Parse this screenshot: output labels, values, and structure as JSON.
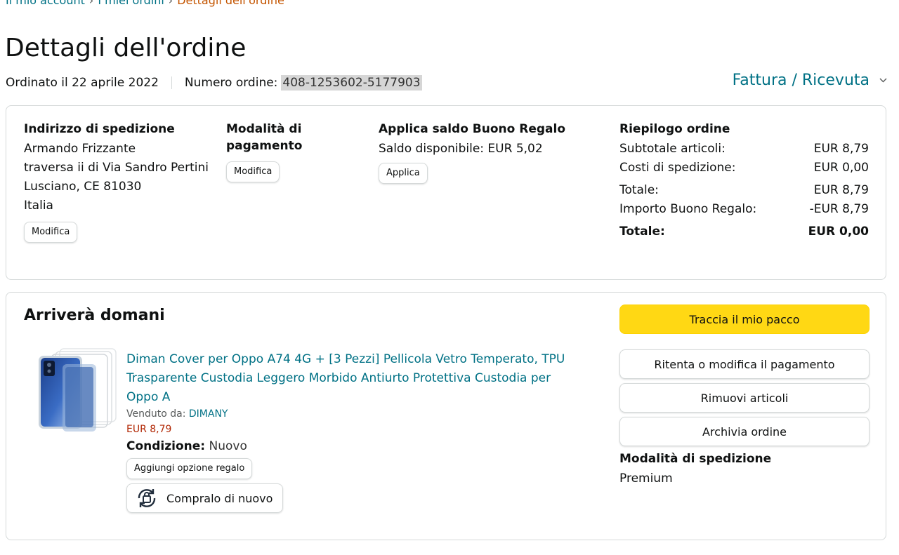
{
  "breadcrumb": {
    "items": [
      "Il mio account",
      "I miei ordini"
    ],
    "current": "Dettagli dell'ordine",
    "separator": "›"
  },
  "page": {
    "title": "Dettagli dell'ordine",
    "ordered_on": "Ordinato il 22 aprile 2022",
    "order_number_label": "Numero ordine:",
    "order_number": "408-1253602-5177903",
    "invoice_link": "Fattura / Ricevuta"
  },
  "shipping_address": {
    "heading": "Indirizzo di spedizione",
    "lines": [
      "Armando Frizzante",
      "traversa ii di Via Sandro Pertini",
      "Lusciano, CE 81030",
      "Italia"
    ],
    "edit_label": "Modifica"
  },
  "payment": {
    "heading": "Modalità di pagamento",
    "edit_label": "Modifica"
  },
  "gift_balance": {
    "heading": "Applica saldo Buono Regalo",
    "available": "Saldo disponibile: EUR 5,02",
    "apply_label": "Applica"
  },
  "summary": {
    "heading": "Riepilogo ordine",
    "rows": [
      {
        "label": "Subtotale articoli:",
        "value": "EUR 8,79"
      },
      {
        "label": "Costi di spedizione:",
        "value": "EUR 0,00"
      },
      {
        "label": "Totale:",
        "value": "EUR 8,79"
      },
      {
        "label": "Importo Buono Regalo:",
        "value": "-EUR 8,79"
      }
    ],
    "total_label": "Totale:",
    "total_value": "EUR 0,00"
  },
  "shipment": {
    "status": "Arriverà domani",
    "item": {
      "title": "Diman Cover per Oppo A74 4G + [3 Pezzi] Pellicola Vetro Temperato, TPU Trasparente Custodia Leggero Morbido Antiurto Protettiva Custodia per Oppo A",
      "sold_by_label": "Venduto da:",
      "seller": "DIMANY",
      "price": "EUR 8,79",
      "condition_label": "Condizione:",
      "condition_value": "Nuovo",
      "gift_option_label": "Aggiungi opzione regalo",
      "buy_again_label": "Compralo di nuovo"
    },
    "actions": {
      "track": "Traccia il mio pacco",
      "retry_payment": "Ritenta o modifica il pagamento",
      "remove_items": "Rimuovi articoli",
      "archive": "Archivia ordine"
    },
    "shipping_method_heading": "Modalità di spedizione",
    "shipping_method_value": "Premium"
  },
  "icons": {
    "invoice_dropdown": "chevron-down-icon",
    "buy_again": "buy-again-icon",
    "product": "product-thumbnail"
  },
  "colors": {
    "link": "#007185",
    "primary_button": "#FFD814",
    "price": "#B12704",
    "breadcrumb_current": "#C45500"
  }
}
